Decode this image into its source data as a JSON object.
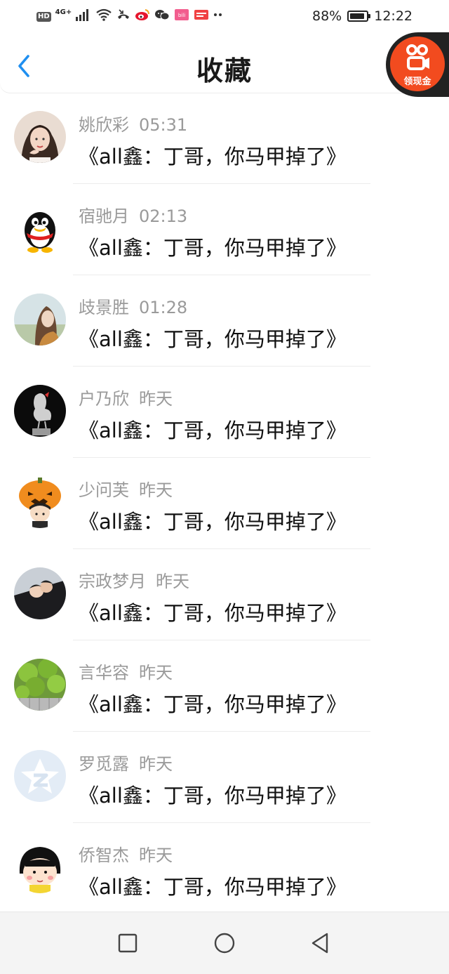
{
  "status_bar": {
    "hd": "HD",
    "network": "4G+",
    "battery": "88%",
    "battery_level": 0.88,
    "time": "12:22",
    "icons": [
      "signal-icon",
      "wifi-icon",
      "missed-call-icon",
      "weibo-icon",
      "wechat-icon",
      "bilibili-icon",
      "toutiao-icon",
      "more-icon"
    ]
  },
  "header": {
    "title": "收藏",
    "back_icon": "chevron-left-icon"
  },
  "floating_badge": {
    "label": "领现金",
    "icon": "kuaishou-icon"
  },
  "items": [
    {
      "name": "姚欣彩",
      "time": "05:31",
      "message": "《all鑫：丁哥，你马甲掉了》",
      "avatar": "girl-photo"
    },
    {
      "name": "宿驰月",
      "time": "02:13",
      "message": "《all鑫：丁哥，你马甲掉了》",
      "avatar": "qq-penguin"
    },
    {
      "name": "歧景胜",
      "time": "01:28",
      "message": "《all鑫：丁哥，你马甲掉了》",
      "avatar": "woman-sky-photo"
    },
    {
      "name": "户乃欣",
      "time": "昨天",
      "message": "《all鑫：丁哥，你马甲掉了》",
      "avatar": "rooster-statue"
    },
    {
      "name": "少问芙",
      "time": "昨天",
      "message": "《all鑫：丁哥，你马甲掉了》",
      "avatar": "pumpkin-boy"
    },
    {
      "name": "宗政梦月",
      "time": "昨天",
      "message": "《all鑫：丁哥，你马甲掉了》",
      "avatar": "couple-photo"
    },
    {
      "name": "言华容",
      "time": "昨天",
      "message": "《all鑫：丁哥，你马甲掉了》",
      "avatar": "green-leaves"
    },
    {
      "name": "罗觅露",
      "time": "昨天",
      "message": "《all鑫：丁哥，你马甲掉了》",
      "avatar": "qzone-star"
    },
    {
      "name": "侨智杰",
      "time": "昨天",
      "message": "《all鑫：丁哥，你马甲掉了》",
      "avatar": "maruko-cartoon"
    }
  ],
  "nav_bar": {
    "buttons": [
      "recent-apps-icon",
      "home-icon",
      "back-icon"
    ]
  },
  "colors": {
    "accent_blue": "#1f8ff0",
    "name_gray": "#9a9a9a",
    "message_black": "#111111",
    "badge_orange": "#f24b1f"
  }
}
